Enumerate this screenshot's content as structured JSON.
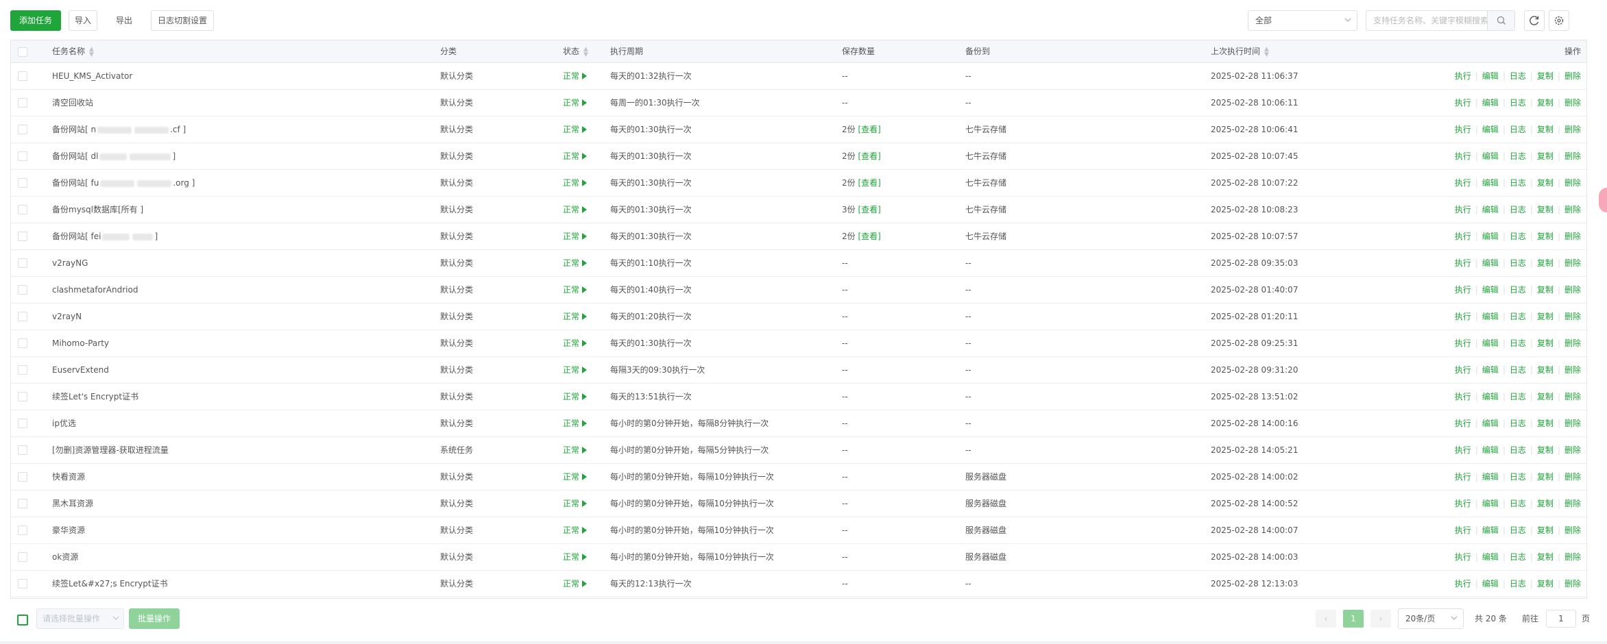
{
  "toolbar": {
    "add_task": "添加任务",
    "import": "导入",
    "export": "导出",
    "log_cut": "日志切割设置",
    "filter_value": "全部",
    "search_placeholder": "支持任务名称、关键字模糊搜索"
  },
  "icons": {
    "search": "search-icon",
    "refresh": "refresh-icon",
    "settings": "gear-icon",
    "sort": "sort-icon",
    "run": "play-triangle-icon"
  },
  "colors": {
    "accent": "#20a53a",
    "highlight": "#e0332e"
  },
  "table": {
    "headers": {
      "name": "任务名称",
      "category": "分类",
      "status": "状态",
      "cycle": "执行周期",
      "keep": "保存数量",
      "backup": "备份到",
      "last": "上次执行时间",
      "ops": "操作"
    },
    "ops_labels": [
      "执行",
      "编辑",
      "日志",
      "复制",
      "删除"
    ],
    "rows": [
      {
        "name": "HEU_KMS_Activator",
        "category": "默认分类",
        "status": "正常",
        "cycle": "每天的01:32执行一次",
        "keep": "--",
        "keep_link": "",
        "backup": "--",
        "last": "2025-02-28 11:06:37"
      },
      {
        "name": "清空回收站",
        "category": "默认分类",
        "status": "正常",
        "cycle": "每周一的01:30执行一次",
        "keep": "--",
        "keep_link": "",
        "backup": "--",
        "last": "2025-02-28 10:06:11"
      },
      {
        "name": "备份网站[ n",
        "name_tail": ".cf ]",
        "category": "默认分类",
        "status": "正常",
        "cycle": "每天的01:30执行一次",
        "keep": "2份",
        "keep_link": "[查看]",
        "backup": "七牛云存储",
        "last": "2025-02-28 10:06:41"
      },
      {
        "name": "备份网站[ dl",
        "name_tail": "]",
        "category": "默认分类",
        "status": "正常",
        "cycle": "每天的01:30执行一次",
        "keep": "2份",
        "keep_link": "[查看]",
        "backup": "七牛云存储",
        "last": "2025-02-28 10:07:45"
      },
      {
        "name": "备份网站[ fu",
        "name_tail": ".org ]",
        "category": "默认分类",
        "status": "正常",
        "cycle": "每天的01:30执行一次",
        "keep": "2份",
        "keep_link": "[查看]",
        "backup": "七牛云存储",
        "last": "2025-02-28 10:07:22"
      },
      {
        "name": "备份mysql数据库[所有 ]",
        "category": "默认分类",
        "status": "正常",
        "cycle": "每天的01:30执行一次",
        "keep": "3份",
        "keep_link": "[查看]",
        "backup": "七牛云存储",
        "last": "2025-02-28 10:08:23"
      },
      {
        "name": "备份网站[ fei",
        "name_tail": "]",
        "category": "默认分类",
        "status": "正常",
        "cycle": "每天的01:30执行一次",
        "keep": "2份",
        "keep_link": "[查看]",
        "backup": "七牛云存储",
        "last": "2025-02-28 10:07:57"
      },
      {
        "name": "v2rayNG",
        "category": "默认分类",
        "status": "正常",
        "cycle": "每天的01:10执行一次",
        "keep": "--",
        "keep_link": "",
        "backup": "--",
        "last": "2025-02-28 09:35:03"
      },
      {
        "name": "clashmetaforAndriod",
        "category": "默认分类",
        "status": "正常",
        "cycle": "每天的01:40执行一次",
        "keep": "--",
        "keep_link": "",
        "backup": "--",
        "last": "2025-02-28 01:40:07"
      },
      {
        "name": "v2rayN",
        "category": "默认分类",
        "status": "正常",
        "cycle": "每天的01:20执行一次",
        "keep": "--",
        "keep_link": "",
        "backup": "--",
        "last": "2025-02-28 01:20:11"
      },
      {
        "name": "Mihomo-Party",
        "category": "默认分类",
        "status": "正常",
        "cycle": "每天的01:30执行一次",
        "keep": "--",
        "keep_link": "",
        "backup": "--",
        "last": "2025-02-28 09:25:31"
      },
      {
        "name": "EuservExtend",
        "category": "默认分类",
        "status": "正常",
        "cycle": "每隔3天的09:30执行一次",
        "keep": "--",
        "keep_link": "",
        "backup": "--",
        "last": "2025-02-28 09:31:20"
      },
      {
        "name": "续签Let's Encrypt证书",
        "category": "默认分类",
        "status": "正常",
        "cycle": "每天的13:51执行一次",
        "keep": "--",
        "keep_link": "",
        "backup": "--",
        "last": "2025-02-28 13:51:02"
      },
      {
        "name": "ip优选",
        "category": "默认分类",
        "status": "正常",
        "cycle": "每小时的第0分钟开始，每隔8分钟执行一次",
        "keep": "--",
        "keep_link": "",
        "backup": "--",
        "last": "2025-02-28 14:00:16"
      },
      {
        "name": "[勿删]资源管理器-获取进程流量",
        "category": "系统任务",
        "status": "正常",
        "cycle": "每小时的第0分钟开始，每隔5分钟执行一次",
        "keep": "--",
        "keep_link": "",
        "backup": "--",
        "last": "2025-02-28 14:05:21"
      },
      {
        "name": "快看资源",
        "category": "默认分类",
        "status": "正常",
        "cycle": "每小时的第0分钟开始，每隔10分钟执行一次",
        "keep": "--",
        "keep_link": "",
        "backup": "服务器磁盘",
        "last": "2025-02-28 14:00:02"
      },
      {
        "name": "黑木耳资源",
        "category": "默认分类",
        "status": "正常",
        "cycle": "每小时的第0分钟开始，每隔10分钟执行一次",
        "keep": "--",
        "keep_link": "",
        "backup": "服务器磁盘",
        "last": "2025-02-28 14:00:52"
      },
      {
        "name": "豪华资源",
        "category": "默认分类",
        "status": "正常",
        "cycle": "每小时的第0分钟开始，每隔10分钟执行一次",
        "keep": "--",
        "keep_link": "",
        "backup": "服务器磁盘",
        "last": "2025-02-28 14:00:07"
      },
      {
        "name": "ok资源",
        "category": "默认分类",
        "status": "正常",
        "cycle": "每小时的第0分钟开始，每隔10分钟执行一次",
        "keep": "--",
        "keep_link": "",
        "backup": "服务器磁盘",
        "last": "2025-02-28 14:00:03"
      },
      {
        "name": "续签Let&#x27;s Encrypt证书",
        "category": "默认分类",
        "status": "正常",
        "cycle": "每天的12:13执行一次",
        "keep": "--",
        "keep_link": "",
        "backup": "--",
        "last": "2025-02-28 12:13:03"
      }
    ]
  },
  "footer": {
    "batch_placeholder": "请选择批量操作",
    "batch_button": "批量操作",
    "prev": "‹",
    "current_page": "1",
    "next": "›",
    "page_size": "20条/页",
    "total": "共 20 条",
    "goto_prefix": "前往",
    "goto_value": "1",
    "goto_suffix": "页"
  }
}
